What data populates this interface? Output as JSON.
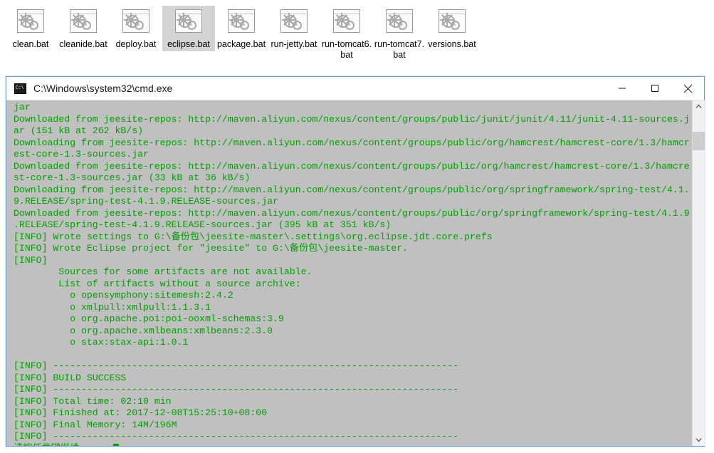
{
  "desktop": {
    "icons": [
      {
        "label": "clean.bat",
        "icon": "bat-file-gears-icon",
        "selected": false
      },
      {
        "label": "cleanide.bat",
        "icon": "bat-file-gears-icon",
        "selected": false
      },
      {
        "label": "deploy.bat",
        "icon": "bat-file-gears-icon",
        "selected": false
      },
      {
        "label": "eclipse.bat",
        "icon": "bat-file-gears-icon",
        "selected": true
      },
      {
        "label": "package.bat",
        "icon": "bat-file-gears-icon",
        "selected": false
      },
      {
        "label": "run-jetty.bat",
        "icon": "bat-file-gears-icon",
        "selected": false
      },
      {
        "label": "run-tomcat6.bat",
        "icon": "bat-file-gears-icon",
        "selected": false
      },
      {
        "label": "run-tomcat7.bat",
        "icon": "bat-file-gears-icon",
        "selected": false
      },
      {
        "label": "versions.bat",
        "icon": "bat-file-gears-icon",
        "selected": false
      }
    ]
  },
  "window": {
    "title": "C:\\Windows\\system32\\cmd.exe",
    "icon": "cmd-console-icon",
    "controls": {
      "minimize": "minimize-button",
      "maximize": "maximize-button",
      "close": "close-button"
    },
    "colors": {
      "border": "#6b9fd4",
      "titlebar_bg": "#ffffff",
      "console_bg": "#c0c0c0",
      "console_fg": "#00a000",
      "scrollbar_bg": "#f0f0f0",
      "scrollbar_thumb": "#cdcdcd"
    }
  },
  "console": {
    "lines": [
      "jar",
      "Downloaded from jeesite-repos: http://maven.aliyun.com/nexus/content/groups/public/junit/junit/4.11/junit-4.11-sources.j",
      "ar (151 kB at 262 kB/s)",
      "Downloading from jeesite-repos: http://maven.aliyun.com/nexus/content/groups/public/org/hamcrest/hamcrest-core/1.3/hamcr",
      "est-core-1.3-sources.jar",
      "Downloaded from jeesite-repos: http://maven.aliyun.com/nexus/content/groups/public/org/hamcrest/hamcrest-core/1.3/hamcre",
      "st-core-1.3-sources.jar (33 kB at 36 kB/s)",
      "Downloading from jeesite-repos: http://maven.aliyun.com/nexus/content/groups/public/org/springframework/spring-test/4.1.",
      "9.RELEASE/spring-test-4.1.9.RELEASE-sources.jar",
      "Downloaded from jeesite-repos: http://maven.aliyun.com/nexus/content/groups/public/org/springframework/spring-test/4.1.9",
      ".RELEASE/spring-test-4.1.9.RELEASE-sources.jar (395 kB at 351 kB/s)",
      "[INFO] Wrote settings to G:\\备份包\\jeesite-master\\.settings\\org.eclipse.jdt.core.prefs",
      "[INFO] Wrote Eclipse project for \"jeesite\" to G:\\备份包\\jeesite-master.",
      "[INFO]",
      "        Sources for some artifacts are not available.",
      "        List of artifacts without a source archive:",
      "          o opensymphony:sitemesh:2.4.2",
      "          o xmlpull:xmlpull:1.1.3.1",
      "          o org.apache.poi:poi-ooxml-schemas:3.9",
      "          o org.apache.xmlbeans:xmlbeans:2.3.0",
      "          o stax:stax-api:1.0.1",
      "",
      "[INFO] ------------------------------------------------------------------------",
      "[INFO] BUILD SUCCESS",
      "[INFO] ------------------------------------------------------------------------",
      "[INFO] Total time: 02:10 min",
      "[INFO] Finished at: 2017-12-08T15:25:10+08:00",
      "[INFO] Final Memory: 14M/196M",
      "[INFO] ------------------------------------------------------------------------"
    ],
    "prompt_line": "请按任意键继续. . . ",
    "cursor": "block-cursor"
  },
  "scrollbar": {
    "up_arrow": "scroll-up-arrow-icon",
    "down_arrow": "scroll-down-arrow-icon",
    "thumb": "scrollbar-thumb"
  }
}
